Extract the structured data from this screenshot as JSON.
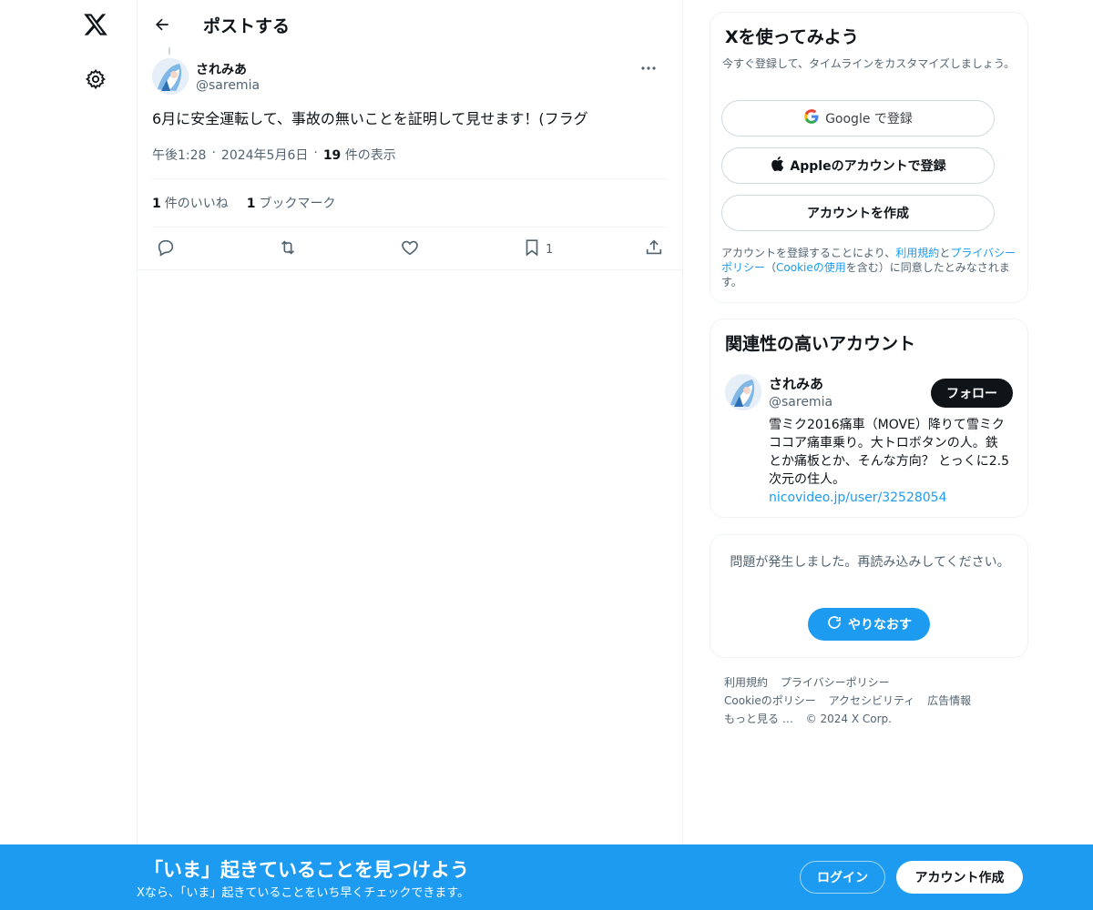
{
  "colors": {
    "accent": "#1d9bf0",
    "text": "#0f1419",
    "muted": "#536471",
    "border": "#eff3f4"
  },
  "nav": {
    "logo_icon": "x-logo-icon",
    "settings_icon": "gear-icon"
  },
  "header": {
    "title": "ポストする"
  },
  "post": {
    "author_name": "されみあ",
    "author_handle": "@saremia",
    "text": "6月に安全運転して、事故の無いことを証明して見せます！(フラグ",
    "time": "午後1:28",
    "date": "2024年5月6日",
    "views_count": "19",
    "views_label": "件の表示",
    "likes_count": "1",
    "likes_label": "件のいいね",
    "bookmarks_count": "1",
    "bookmarks_label": "ブックマーク",
    "bookmark_action_count": "1"
  },
  "signup": {
    "title": "Xを使ってみよう",
    "subtitle": "今すぐ登録して、タイムラインをカスタマイズしましょう。",
    "google": "Google で登録",
    "apple": "Appleのアカウントで登録",
    "create": "アカウントを作成",
    "terms_pre": "アカウントを登録することにより、",
    "terms_link1": "利用規約",
    "terms_and": "と",
    "terms_link2": "プライバシーポリシー",
    "terms_paren_open": "（",
    "terms_link3": "Cookieの使用",
    "terms_post": "を含む）に同意したとみなされます。"
  },
  "related": {
    "title": "関連性の高いアカウント",
    "name": "されみあ",
    "handle": "@saremia",
    "follow": "フォロー",
    "bio": "雪ミク2016痛車（MOVE）降りて雪ミクココア痛車乗り。大トロボタンの人。鉄とか痛板とか、そんな方向？ とっくに2.5次元の住人。",
    "link": "nicovideo.jp/user/32528054"
  },
  "error": {
    "text": "問題が発生しました。再読み込みしてください。",
    "retry": "やりなおす"
  },
  "footer": {
    "links": [
      "利用規約",
      "プライバシーポリシー",
      "Cookieのポリシー",
      "アクセシビリティ",
      "広告情報",
      "もっと見る …",
      "© 2024 X Corp."
    ]
  },
  "banner": {
    "title": "「いま」起きていることを見つけよう",
    "subtitle": "Xなら、「いま」起きていることをいち早くチェックできます。",
    "login": "ログイン",
    "create": "アカウント作成"
  }
}
